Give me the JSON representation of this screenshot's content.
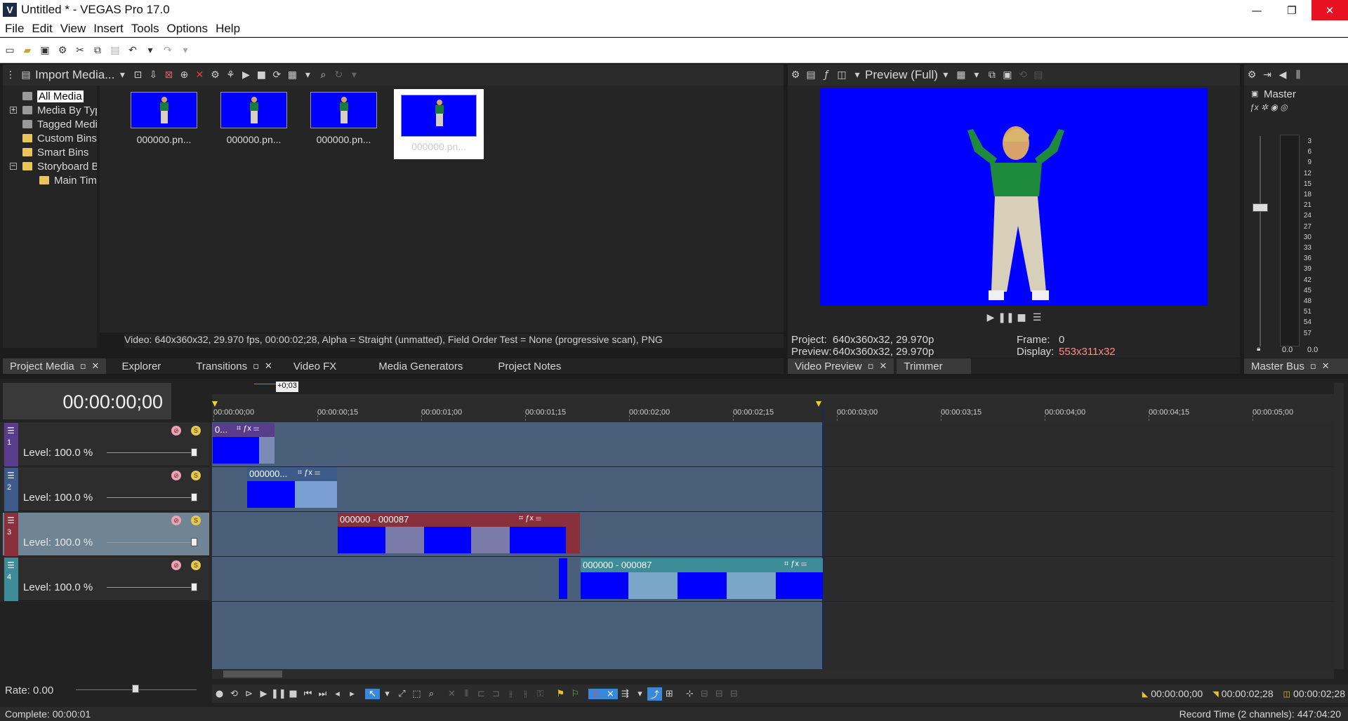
{
  "window": {
    "title": "Untitled * - VEGAS Pro 17.0",
    "logo": "V",
    "minimize": "—",
    "restore": "❐",
    "close": "✕"
  },
  "menu": [
    "File",
    "Edit",
    "View",
    "Insert",
    "Tools",
    "Options",
    "Help"
  ],
  "project_media": {
    "toolbar_label": "Import Media...",
    "tree": [
      {
        "label": "All Media",
        "selected": true
      },
      {
        "label": "Media By Type",
        "expander": "+"
      },
      {
        "label": "Tagged Media"
      },
      {
        "label": "Custom Bins"
      },
      {
        "label": "Smart Bins"
      },
      {
        "label": "Storyboard Bins",
        "expander": "−"
      },
      {
        "label": "Main Timeline"
      }
    ],
    "thumbnails": [
      "000000.pn...",
      "000000.pn...",
      "000000.pn...",
      "000000.pn..."
    ],
    "status": "Video: 640x360x32, 29.970 fps, 00:00:02;28, Alpha = Straight (unmatted), Field Order Test = None (progressive scan), PNG",
    "tabs": [
      "Project Media",
      "Explorer",
      "Transitions",
      "Video FX",
      "Media Generators",
      "Project Notes"
    ]
  },
  "preview": {
    "mode": "Preview (Full)",
    "project_label": "Project:",
    "project_value": "640x360x32, 29.970p",
    "preview_label": "Preview:",
    "preview_value": "640x360x32, 29.970p",
    "frame_label": "Frame:",
    "frame_value": "0",
    "display_label": "Display:",
    "display_value": "553x311x32",
    "tabs": [
      "Video Preview",
      "Trimmer"
    ]
  },
  "master": {
    "label": "Master",
    "scale": [
      "3",
      "6",
      "9",
      "12",
      "15",
      "18",
      "21",
      "24",
      "27",
      "30",
      "33",
      "36",
      "39",
      "42",
      "45",
      "48",
      "51",
      "54",
      "57"
    ],
    "left_value": "0.0",
    "right_value": "0.0",
    "tab": "Master Bus"
  },
  "timeline": {
    "timecode": "00:00:00;00",
    "offset_badge": "+0;03",
    "ruler": [
      "00:00:00;00",
      "00:00:00;15",
      "00:00:01;00",
      "00:00:01;15",
      "00:00:02;00",
      "00:00:02;15",
      "00:00:03;00",
      "00:00:03;15",
      "00:00:04;00",
      "00:00:04;15",
      "00:00:05;00"
    ],
    "tracks": [
      {
        "number": "1",
        "level": "Level: 100.0 %",
        "color": "#5a3c8c"
      },
      {
        "number": "2",
        "level": "Level: 100.0 %",
        "color": "#3d5a8a"
      },
      {
        "number": "3",
        "level": "Level: 100.0 %",
        "color": "#8a2f3c"
      },
      {
        "number": "4",
        "level": "Level: 100.0 %",
        "color": "#3e8c97"
      }
    ],
    "clips": {
      "t1": "0...",
      "t2": "000000...",
      "t3": "000000 - 000087",
      "t4": "000000 - 000087"
    },
    "rate": "Rate: 0.00",
    "start_time": "00:00:00;00",
    "end_time": "00:00:02;28",
    "length_time": "00:00:02;28"
  },
  "status": {
    "left": "Complete: 00:00:01",
    "right": "Record Time (2 channels): 447:04:20"
  },
  "colors": {
    "accent": "#3a88d8",
    "display_value": "#ff8a8a"
  }
}
